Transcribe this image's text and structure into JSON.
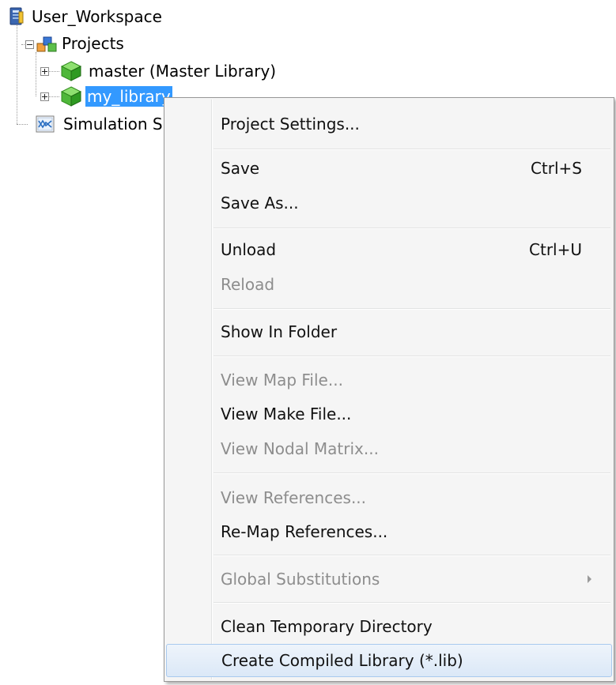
{
  "tree": {
    "workspace": {
      "label": "User_Workspace",
      "icon": "workspace-server-icon"
    },
    "projects": {
      "label": "Projects",
      "icon": "projects-blocks-icon",
      "expanded": true
    },
    "master": {
      "label": "master (Master Library)",
      "icon": "library-cube-icon",
      "expanded": false
    },
    "my_library": {
      "label": "my_library",
      "icon": "library-cube-icon",
      "expanded": false,
      "selected": true
    },
    "simulation": {
      "label": "Simulation S",
      "icon": "simulation-scope-icon"
    }
  },
  "context_menu": {
    "items": [
      {
        "label": "Project Settings...",
        "shortcut": "",
        "enabled": true
      },
      {
        "label": "Save",
        "shortcut": "Ctrl+S",
        "enabled": true
      },
      {
        "label": "Save As...",
        "shortcut": "",
        "enabled": true
      },
      {
        "label": "Unload",
        "shortcut": "Ctrl+U",
        "enabled": true
      },
      {
        "label": "Reload",
        "shortcut": "",
        "enabled": false
      },
      {
        "label": "Show In Folder",
        "shortcut": "",
        "enabled": true
      },
      {
        "label": "View Map File...",
        "shortcut": "",
        "enabled": false
      },
      {
        "label": "View Make File...",
        "shortcut": "",
        "enabled": true
      },
      {
        "label": "View Nodal Matrix...",
        "shortcut": "",
        "enabled": false
      },
      {
        "label": "View References...",
        "shortcut": "",
        "enabled": false
      },
      {
        "label": "Re-Map References...",
        "shortcut": "",
        "enabled": true
      },
      {
        "label": "Global Substitutions",
        "shortcut": "",
        "enabled": false,
        "submenu": true
      },
      {
        "label": "Clean Temporary Directory",
        "shortcut": "",
        "enabled": true
      },
      {
        "label": "Create Compiled Library (*.lib)",
        "shortcut": "",
        "enabled": true,
        "hovered": true
      }
    ]
  },
  "colors": {
    "selection": "#3399ff",
    "menu_background": "#f5f5f5",
    "menu_border": "#979797",
    "disabled_text": "#8d8d8d",
    "hover_border": "#a8c9ee"
  }
}
